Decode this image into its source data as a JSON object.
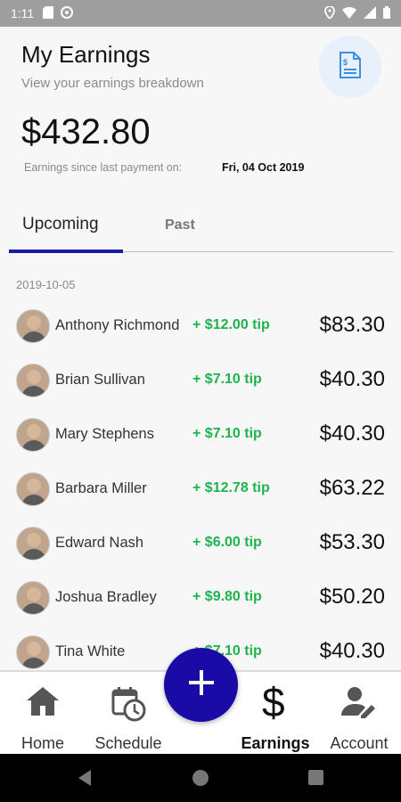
{
  "status_bar": {
    "time": "1:11"
  },
  "header": {
    "title": "My Earnings",
    "subtitle": "View your earnings breakdown",
    "balance": "$432.80",
    "since_label": "Earnings since last payment on:",
    "since_date": "Fri, 04 Oct 2019",
    "invoice_icon": "invoice-icon"
  },
  "tabs": [
    {
      "label": "Upcoming",
      "active": true
    },
    {
      "label": "Past",
      "active": false
    }
  ],
  "list": {
    "date": "2019-10-05",
    "rows": [
      {
        "name": "Anthony Richmond",
        "tip": "+ $12.00 tip",
        "amount": "$83.30"
      },
      {
        "name": "Brian Sullivan",
        "tip": "+ $7.10 tip",
        "amount": "$40.30"
      },
      {
        "name": "Mary Stephens",
        "tip": "+ $7.10 tip",
        "amount": "$40.30"
      },
      {
        "name": "Barbara Miller",
        "tip": "+ $12.78 tip",
        "amount": "$63.22"
      },
      {
        "name": "Edward Nash",
        "tip": "+ $6.00 tip",
        "amount": "$53.30"
      },
      {
        "name": "Joshua Bradley",
        "tip": "+ $9.80 tip",
        "amount": "$50.20"
      },
      {
        "name": "Tina White",
        "tip": "+ $7.10 tip",
        "amount": "$40.30"
      }
    ]
  },
  "nav": {
    "home": "Home",
    "schedule": "Schedule",
    "earnings": "Earnings",
    "account": "Account"
  },
  "colors": {
    "accent": "#1a0aa6",
    "tip": "#1fb34f",
    "status_bar": "#9e9e9e"
  }
}
